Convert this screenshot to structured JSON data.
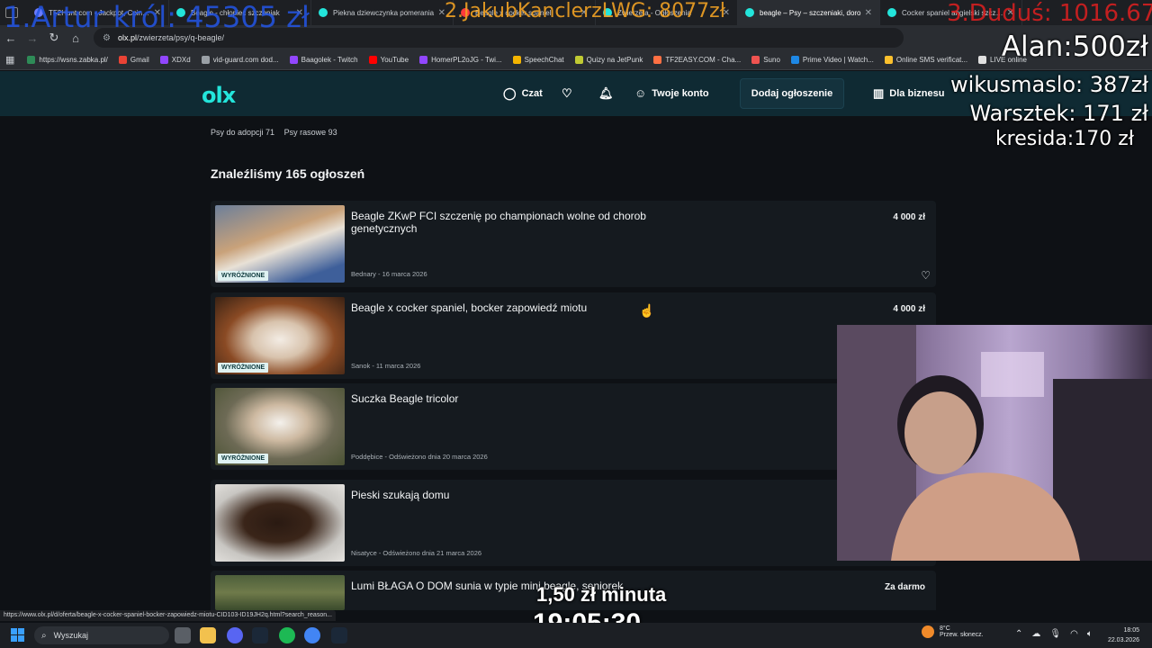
{
  "browser": {
    "tabs": [
      {
        "label": "TF2Hunt.com - Jackpot, Coinflip",
        "color": "#6b7cff",
        "active": false
      },
      {
        "label": "Beagle - chłopiec szczeniak",
        "color": "#23e5db",
        "active": false
      },
      {
        "label": "Piekna dziewczynka pomerania",
        "color": "#23e5db",
        "active": false
      },
      {
        "label": "Beagle x cocker spaniel",
        "color": "#ff3b3b",
        "active": false
      },
      {
        "label": "Zwierzęta - Ogłoszenia",
        "color": "#23e5db",
        "active": false
      },
      {
        "label": "beagle – Psy – szczeniaki, doro",
        "color": "#23e5db",
        "active": true
      },
      {
        "label": "Cocker spaniel angielski szczen",
        "color": "#23e5db",
        "active": false
      }
    ],
    "url_domain": "olx.pl",
    "url_path": "/zwierzeta/psy/q-beagle/",
    "bookmarks": [
      {
        "label": "https://wsns.zabka.pl/",
        "color": "#2e8b57"
      },
      {
        "label": "Gmail",
        "color": "#ea4335"
      },
      {
        "label": "XDXd",
        "color": "#9146ff"
      },
      {
        "label": "vid-guard.com dod...",
        "color": "#9aa0a6"
      },
      {
        "label": "Baagolek - Twitch",
        "color": "#9146ff"
      },
      {
        "label": "YouTube",
        "color": "#ff0000"
      },
      {
        "label": "HomerPL2oJG - Twi...",
        "color": "#9146ff"
      },
      {
        "label": "SpeechChat",
        "color": "#f4b400"
      },
      {
        "label": "Quizy na JetPunk",
        "color": "#c0ca33"
      },
      {
        "label": "TF2EASY.COM - Cha...",
        "color": "#ff7043"
      },
      {
        "label": "Suno",
        "color": "#ef5350"
      },
      {
        "label": "Prime Video | Watch...",
        "color": "#1e88e5"
      },
      {
        "label": "Online SMS verificat...",
        "color": "#fbc02d"
      },
      {
        "label": "LIVE online",
        "color": "#e0e0e0"
      }
    ]
  },
  "olx": {
    "logo": "olx",
    "nav": {
      "chat": "Czat",
      "account": "Twoje konto",
      "add_ad": "Dodaj ogłoszenie",
      "business": "Dla biznesu"
    },
    "categories": [
      "Psy do adopcji 71",
      "Psy rasowe 93"
    ],
    "results_title": "Znaleźliśmy 165 ogłoszeń",
    "badge": "WYRÓŻNIONE",
    "listings": [
      {
        "title": "Beagle ZKwP FCI szczenię po championach wolne od chorob genetycznych",
        "meta": "Bednary - 16 marca 2026",
        "price": "4 000 zł",
        "featured": true,
        "heart": true
      },
      {
        "title": "Beagle x cocker spaniel, bocker zapowiedź miotu",
        "meta": "Sanok - 11 marca 2026",
        "price": "4 000 zł",
        "featured": true,
        "heart": false
      },
      {
        "title": "Suczka Beagle tricolor",
        "meta": "Poddębice - Odświeżono dnia 20 marca 2026",
        "price": "",
        "featured": true,
        "heart": false
      },
      {
        "title": "Pieski szukają domu",
        "meta": "Nisatyce - Odświeżono dnia 21 marca 2026",
        "price": "",
        "featured": false,
        "heart": false
      },
      {
        "title": "Lumi BŁAGA O DOM sunia w typie mini beagle, seniorek",
        "meta": "",
        "price": "Za darmo",
        "featured": false,
        "heart": false
      }
    ]
  },
  "overlay": {
    "top1": "1.Artur król: 45305 zł",
    "top2": "2.JakubKanclerzLWG: 8077zł",
    "top3": "3.Duduś: 1016.67",
    "alan": "Alan:500zł",
    "wikusmaslo": "wikusmaslo: 387zł",
    "warsztek": "Warsztek: 171 zł",
    "kresida": "kresida:170 zł",
    "rate": "1,50 zł minuta",
    "clock": "19:05:30"
  },
  "status_url": "https://www.olx.pl/d/oferta/beagle-x-cocker-spaniel-bocker-zapowiedz-miotu-CID103-ID19JH2q.html?search_reason...",
  "taskbar": {
    "search": "Wyszukaj",
    "weather_temp": "8°C",
    "weather_desc": "Przew. słonecz.",
    "time": "18:05",
    "date": "22.03.2026"
  }
}
